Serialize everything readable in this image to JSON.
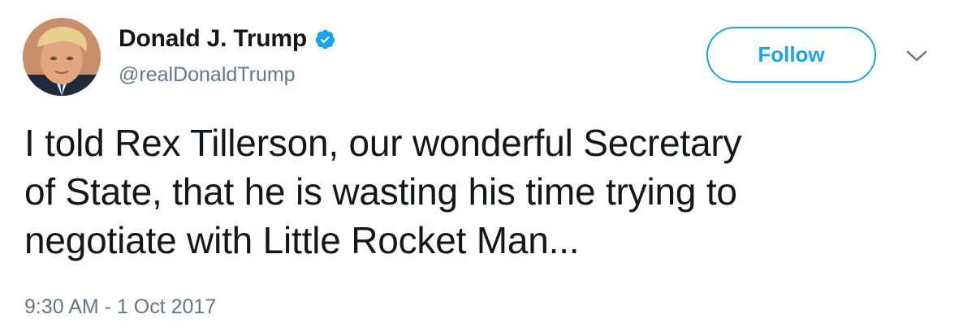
{
  "user": {
    "display_name": "Donald J. Trump",
    "handle": "@realDonaldTrump",
    "verified_icon": "verified-badge-icon",
    "avatar_icon": "profile-photo"
  },
  "actions": {
    "follow_label": "Follow",
    "menu_icon": "chevron-down-icon"
  },
  "tweet": {
    "lines": [
      "I told Rex Tillerson, our wonderful Secretary",
      "of State, that he is wasting his time trying to",
      "negotiate with Little Rocket Man..."
    ],
    "timestamp": "9:30 AM - 1 Oct 2017"
  },
  "colors": {
    "accent": "#1da1f2",
    "text": "#14171a",
    "secondary": "#657786"
  }
}
